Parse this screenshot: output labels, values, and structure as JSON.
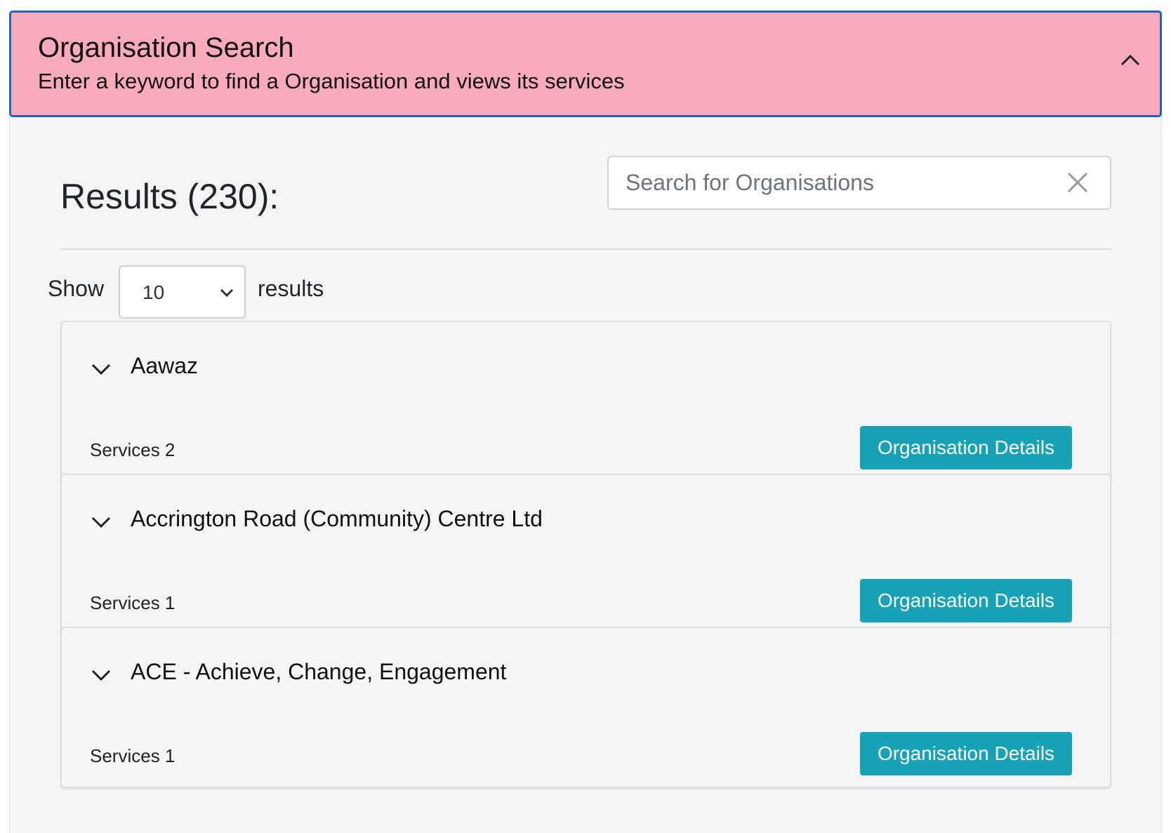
{
  "header": {
    "title": "Organisation Search",
    "subtitle": "Enter a keyword to find a Organisation and views its services",
    "toggle_icon": "chevron-up-icon"
  },
  "results": {
    "heading": "Results (230):"
  },
  "search": {
    "placeholder": "Search for Organisations",
    "value": "",
    "clear_icon": "close-icon"
  },
  "pagination": {
    "show_label": "Show",
    "page_size": "10",
    "results_label": "results"
  },
  "organisations": [
    {
      "name": "Aawaz",
      "services": "Services 2",
      "button": "Organisation Details"
    },
    {
      "name": "Accrington Road (Community) Centre Ltd",
      "services": "Services 1",
      "button": "Organisation Details"
    },
    {
      "name": "ACE - Achieve, Change, Engagement",
      "services": "Services 1",
      "button": "Organisation Details"
    }
  ],
  "colors": {
    "header_bg": "#f9aabd",
    "header_border": "#1f64c5",
    "button_bg": "#17a2b8",
    "panel_bg": "#f5f5f5"
  }
}
